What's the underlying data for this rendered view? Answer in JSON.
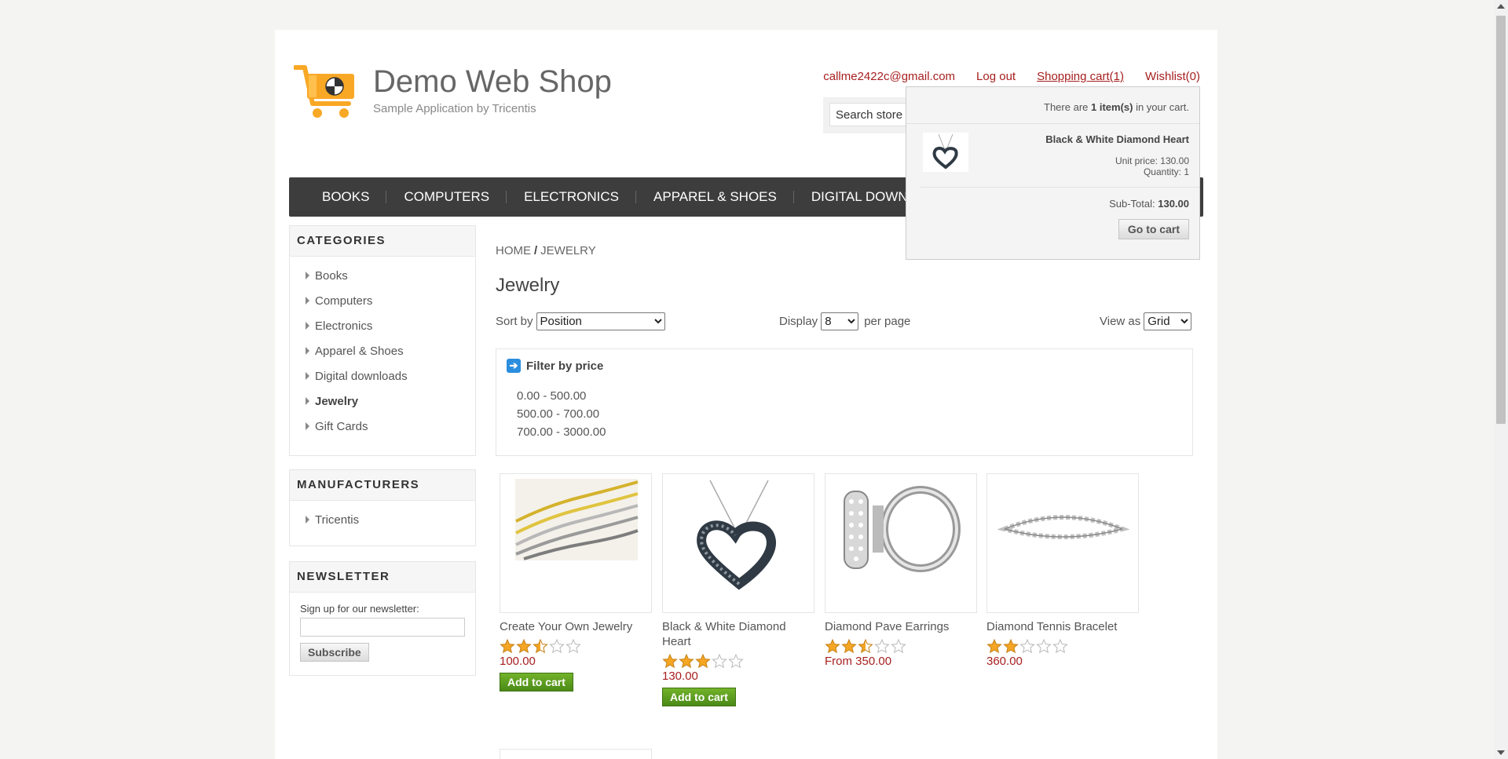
{
  "header": {
    "shop_name": "Demo Web Shop",
    "shop_sub": "Sample Application by Tricentis",
    "links": {
      "email": "callme2422c@gmail.com",
      "logout": "Log out",
      "cart": "Shopping cart(1)",
      "wishlist": "Wishlist(0)"
    },
    "search_placeholder": "Search store"
  },
  "nav": [
    "BOOKS",
    "COMPUTERS",
    "ELECTRONICS",
    "APPAREL & SHOES",
    "DIGITAL DOWN"
  ],
  "flyout": {
    "count_prefix": "There are ",
    "count": "1 item(s)",
    "count_suffix": " in your cart.",
    "item_name": "Black & White Diamond Heart",
    "unit_price": "Unit price: 130.00",
    "quantity": "Quantity: 1",
    "subtotal_label": "Sub-Total: ",
    "subtotal_value": "130.00",
    "go_to_cart": "Go to cart"
  },
  "categories": {
    "title": "CATEGORIES",
    "items": [
      "Books",
      "Computers",
      "Electronics",
      "Apparel & Shoes",
      "Digital downloads",
      "Jewelry",
      "Gift Cards"
    ],
    "active": "Jewelry"
  },
  "manufacturers": {
    "title": "MANUFACTURERS",
    "items": [
      "Tricentis"
    ]
  },
  "newsletter": {
    "title": "NEWSLETTER",
    "label": "Sign up for our newsletter:",
    "button": "Subscribe"
  },
  "breadcrumb": {
    "home": "HOME",
    "sep": "/",
    "current": "JEWELRY"
  },
  "page_title": "Jewelry",
  "options": {
    "sort_label": "Sort by",
    "sort_value": "Position",
    "display_label": "Display",
    "display_value": "8",
    "per_page": "per page",
    "view_label": "View as",
    "view_value": "Grid"
  },
  "filter": {
    "title": "Filter by price",
    "ranges": [
      "0.00 - 500.00",
      "500.00 - 700.00",
      "700.00 - 3000.00"
    ]
  },
  "products": [
    {
      "name": "Create Your Own Jewelry",
      "rating": 2.5,
      "price": "100.00",
      "add_label": "Add to cart"
    },
    {
      "name": "Black & White Diamond Heart",
      "rating": 3,
      "price": "130.00",
      "add_label": "Add to cart"
    },
    {
      "name": "Diamond Pave Earrings",
      "rating": 2.5,
      "price": "From 350.00"
    },
    {
      "name": "Diamond Tennis Bracelet",
      "rating": 2,
      "price": "360.00"
    }
  ],
  "colors": {
    "link": "#a71f1f",
    "nav_bg": "#3d3d3d",
    "button_green": "#5a9b1f",
    "star": "#f5a623"
  }
}
